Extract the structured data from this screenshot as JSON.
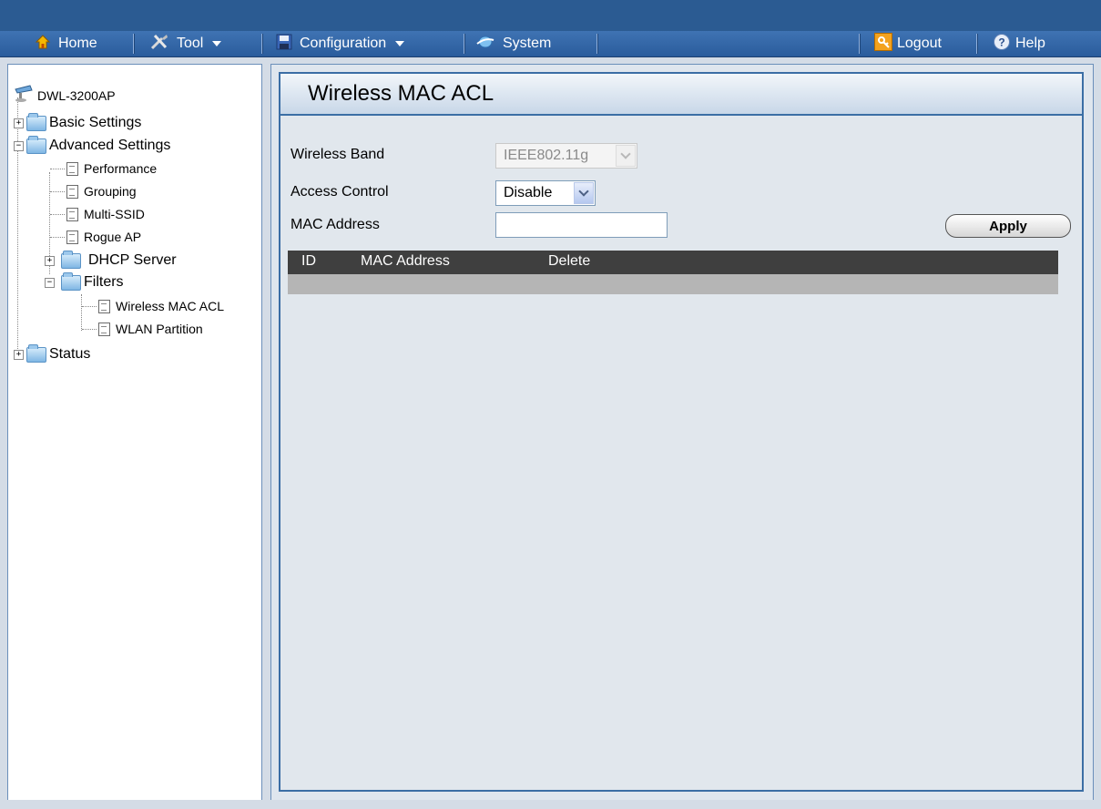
{
  "menu": {
    "home": "Home",
    "tool": "Tool",
    "configuration": "Configuration",
    "system": "System",
    "logout": "Logout",
    "help": "Help"
  },
  "tree": {
    "root": "DWL-3200AP",
    "basic_settings": "Basic Settings",
    "advanced_settings": "Advanced Settings",
    "performance": "Performance",
    "grouping": "Grouping",
    "multi_ssid": "Multi-SSID",
    "rogue_ap": "Rogue AP",
    "dhcp_server": "DHCP Server",
    "filters": "Filters",
    "wireless_mac_acl": "Wireless MAC ACL",
    "wlan_partition": "WLAN Partition",
    "status": "Status"
  },
  "page": {
    "title": "Wireless MAC ACL",
    "wireless_band_label": "Wireless Band",
    "wireless_band_value": "IEEE802.11g",
    "access_control_label": "Access Control",
    "access_control_value": "Disable",
    "mac_address_label": "MAC Address",
    "mac_address_value": "",
    "apply_label": "Apply"
  },
  "table": {
    "columns": [
      "ID",
      "MAC Address",
      "Delete"
    ],
    "rows": []
  },
  "colors": {
    "menubar": "#2a5c9c",
    "panel_border": "#3b6ea5",
    "table_header": "#3f3f3f",
    "table_row": "#b5b5b5"
  }
}
